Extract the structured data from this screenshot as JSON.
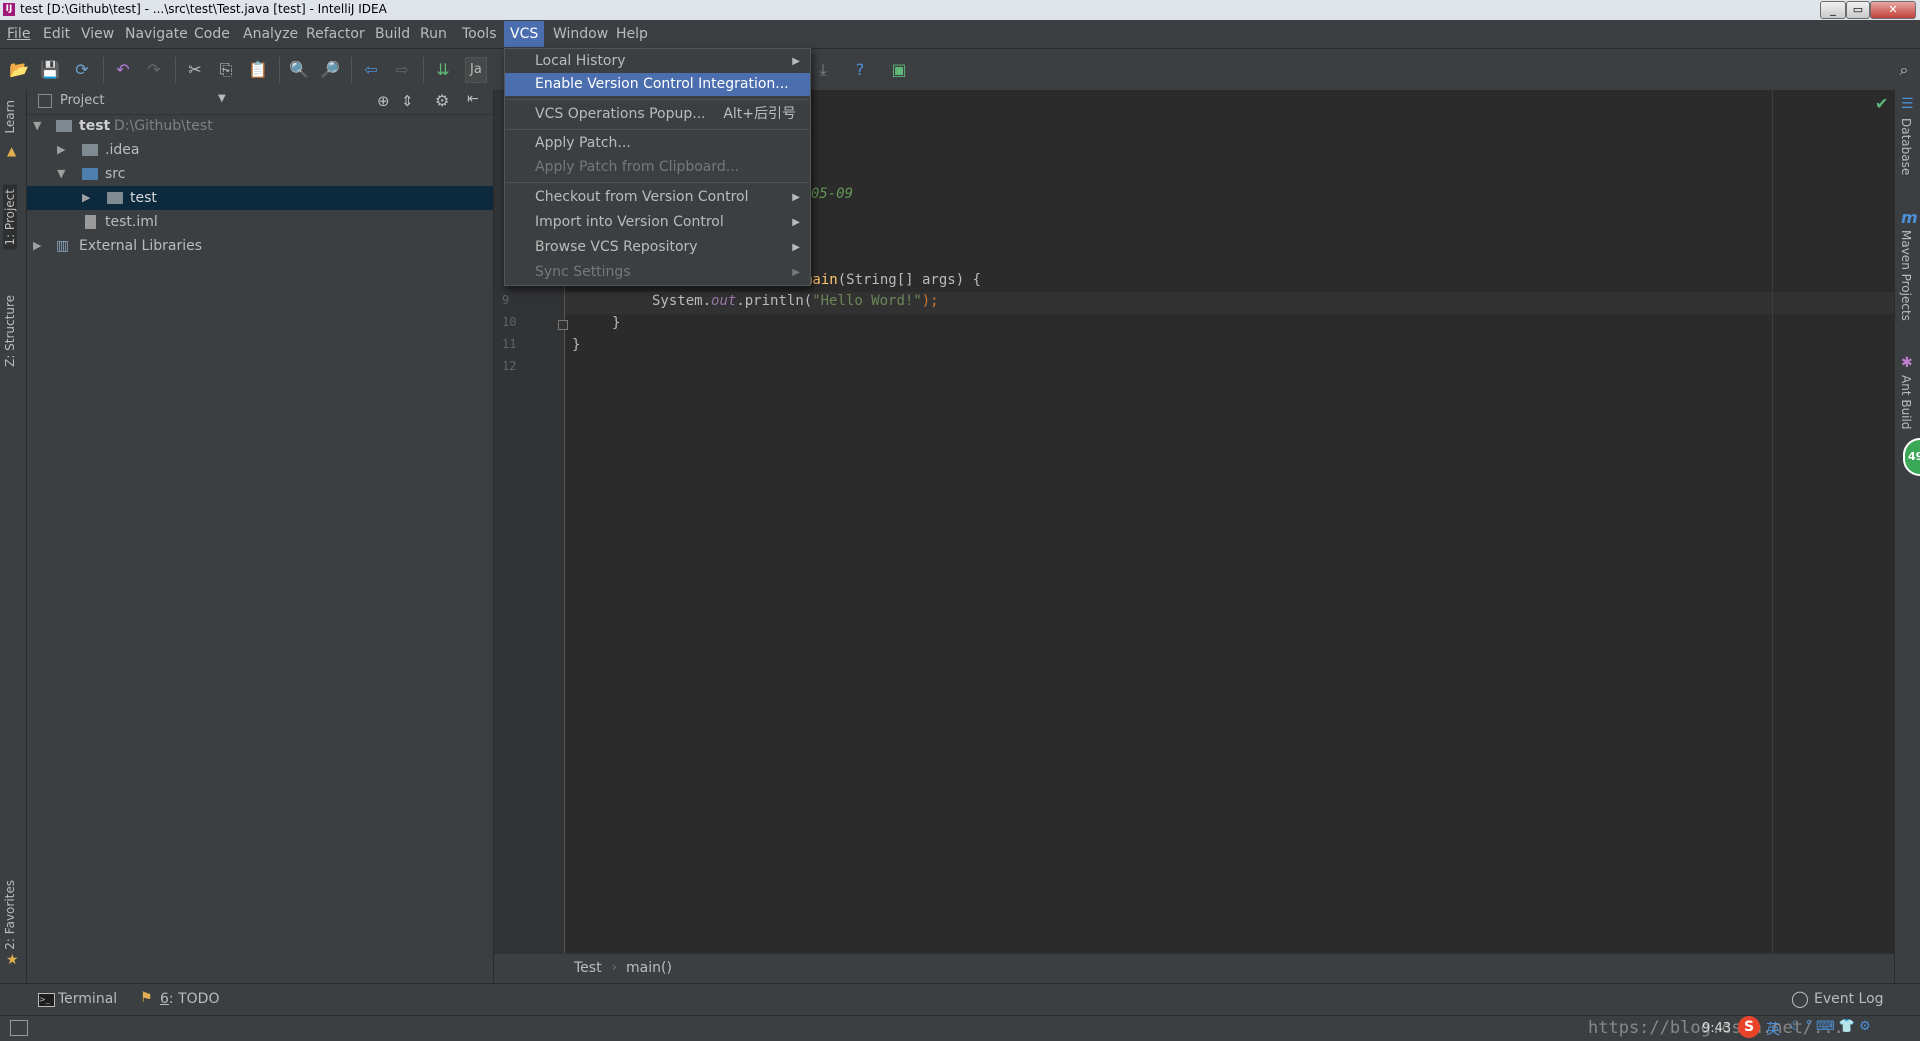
{
  "window": {
    "title": "test [D:\\Github\\test] - ...\\src\\test\\Test.java [test] - IntelliJ IDEA",
    "app_icon": "IJ",
    "controls": [
      "_",
      "▭",
      "✕"
    ]
  },
  "menubar": {
    "items": [
      "File",
      "Edit",
      "View",
      "Navigate",
      "Code",
      "Analyze",
      "Refactor",
      "Build",
      "Run",
      "Tools",
      "VCS",
      "Window",
      "Help"
    ],
    "active": "VCS"
  },
  "toolbar": {
    "run_config_label": "Ja"
  },
  "left_strip": {
    "tabs": [
      "Learn",
      "1: Project",
      "Z: Structure",
      "2: Favorites"
    ]
  },
  "right_strip": {
    "tabs": [
      "Database",
      "Maven Projects",
      "Ant Build"
    ],
    "badge": "49"
  },
  "project_panel": {
    "header": "Project",
    "tree": [
      {
        "label": "test",
        "path": "D:\\Github\\test",
        "expanded": true
      },
      {
        "label": ".idea",
        "expanded": false
      },
      {
        "label": "src",
        "expanded": true
      },
      {
        "label": "test",
        "expanded": false,
        "selected": true
      },
      {
        "label": "test.iml"
      },
      {
        "label": "External Libraries",
        "expanded": false
      }
    ]
  },
  "editor": {
    "line_numbers": [
      "9",
      "10",
      "11",
      "12"
    ],
    "date_fragment": "8-05-09",
    "main_sig_fn": "main",
    "main_sig_rest": "(String[] args) {",
    "println_pre": "System.",
    "println_field": "out",
    "println_call": ".println(",
    "println_str": "\"Hello Word!\"",
    "println_end": ");",
    "close_brace_inner": "}",
    "close_brace_outer": "}"
  },
  "breadcrumbs": {
    "items": [
      "Test",
      "main()"
    ],
    "separator": "›"
  },
  "bottombar": {
    "terminal": "Terminal",
    "todo_prefix": "6",
    "todo_label": ": TODO",
    "event_log": "Event Log"
  },
  "statusbar": {
    "time": "9:43",
    "watermark": "https://blog.csdn.net/...",
    "ime": "英"
  },
  "vcs_menu": {
    "items": [
      {
        "label": "Local History",
        "submenu": true
      },
      {
        "label": "Enable Version Control Integration...",
        "highlighted": true
      },
      {
        "label": "VCS Operations Popup...",
        "shortcut": "Alt+后引号"
      },
      {
        "label": "Apply Patch..."
      },
      {
        "label": "Apply Patch from Clipboard...",
        "disabled": true
      },
      {
        "label": "Checkout from Version Control",
        "submenu": true
      },
      {
        "label": "Import into Version Control",
        "submenu": true
      },
      {
        "label": "Browse VCS Repository",
        "submenu": true
      },
      {
        "label": "Sync Settings",
        "submenu": true,
        "disabled": true
      }
    ]
  },
  "colors": {
    "accent": "#4b6eaf",
    "background": "#2b2b2b",
    "panel": "#3c3f41",
    "selection": "#0d293e"
  }
}
